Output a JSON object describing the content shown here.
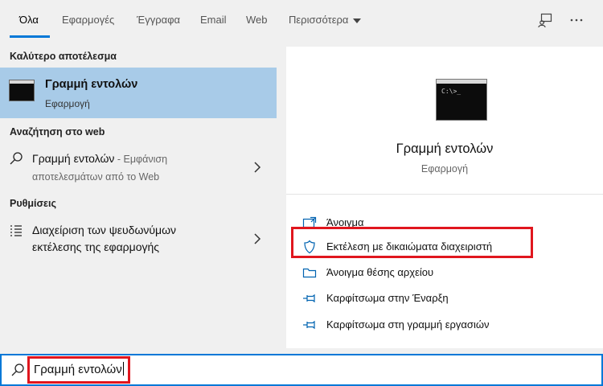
{
  "tabs": [
    {
      "label": "Όλα",
      "active": true
    },
    {
      "label": "Εφαρμογές"
    },
    {
      "label": "Έγγραφα"
    },
    {
      "label": "Email"
    },
    {
      "label": "Web"
    },
    {
      "label": "Περισσότερα"
    }
  ],
  "top_icons": [
    "feedback-icon",
    "more-options-icon"
  ],
  "left": {
    "best_match_title": "Καλύτερο αποτέλεσμα",
    "best_match": {
      "name": "Γραμμή εντολών",
      "type": "Εφαρμογή"
    },
    "web_title": "Αναζήτηση στο web",
    "web_result": {
      "query": "Γραμμή εντολών",
      "suffix": " - Εμφάνιση",
      "line2": "αποτελεσμάτων από το Web"
    },
    "settings_title": "Ρυθμίσεις",
    "settings_result": {
      "line1": "Διαχείριση των ψευδωνύμων",
      "line2": "εκτέλεσης της εφαρμογής"
    }
  },
  "right": {
    "app_name": "Γραμμή εντολών",
    "app_type": "Εφαρμογή",
    "actions": [
      {
        "label": "Άνοιγμα",
        "icon": "open-icon"
      },
      {
        "label": "Εκτέλεση με δικαιώματα διαχειριστή",
        "icon": "shield-icon"
      },
      {
        "label": "Άνοιγμα θέσης αρχείου",
        "icon": "folder-icon"
      },
      {
        "label": "Καρφίτσωμα στην Έναρξη",
        "icon": "pin-icon"
      },
      {
        "label": "Καρφίτσωμα στη γραμμή εργασιών",
        "icon": "pin-icon"
      }
    ]
  },
  "search": {
    "value": "Γραμμή εντολών"
  },
  "colors": {
    "accent": "#0078d7",
    "selection": "#a8cbe8",
    "highlight": "#e0161e"
  }
}
